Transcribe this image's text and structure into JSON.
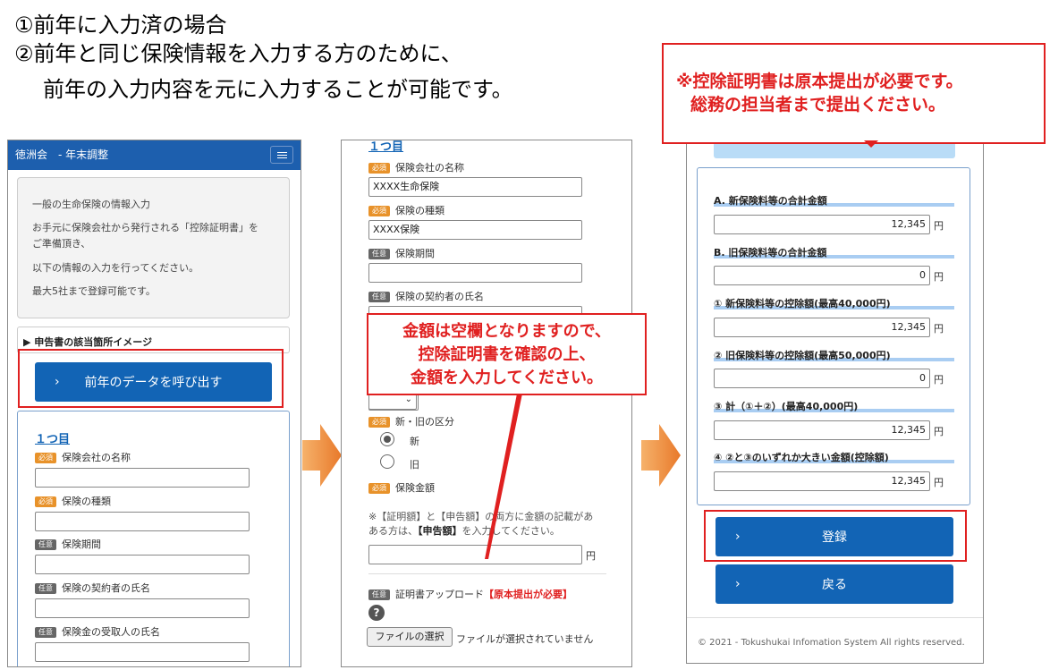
{
  "slide": {
    "line1": "①前年に入力済の場合",
    "line2": "②前年と同じ保険情報を入力する方のために、",
    "line3": "前年の入力内容を元に入力することが可能です。"
  },
  "notice": {
    "line1": "※控除証明書は原本提出が必要です。",
    "line2": "総務の担当者まで提出ください。"
  },
  "callout": {
    "line1": "金額は空欄となりますので、",
    "line2": "控除証明書を確認の上、",
    "line3": "金額を入力してください。"
  },
  "screen1": {
    "app_title": "徳洲会　- 年末調整",
    "intro": {
      "title": "一般の生命保険の情報入力",
      "p1a": "お手元に保険会社から発行される「控除証明書」を",
      "p1b": "ご準備頂き、",
      "p2": "以下の情報の入力を行ってください。",
      "p3": "最大5社まで登録可能です。"
    },
    "toggle": "▶ 申告書の該当箇所イメージ",
    "load_button": "前年のデータを呼び出す",
    "section_title": "１つ目",
    "fields": [
      {
        "badge": "必須",
        "label": "保険会社の名称",
        "value": ""
      },
      {
        "badge": "必須",
        "label": "保険の種類",
        "value": ""
      },
      {
        "badge": "任意",
        "label": "保険期間",
        "value": ""
      },
      {
        "badge": "任意",
        "label": "保険の契約者の氏名",
        "value": ""
      },
      {
        "badge": "任意",
        "label": "保険金の受取人の氏名",
        "value": ""
      }
    ]
  },
  "screen2": {
    "section_title": "１つ目",
    "fields": [
      {
        "badge": "必須",
        "label": "保険会社の名称",
        "value": "XXXX生命保険"
      },
      {
        "badge": "必須",
        "label": "保険の種類",
        "value": "XXXX保険"
      },
      {
        "badge": "任意",
        "label": "保険期間",
        "value": ""
      },
      {
        "badge": "任意",
        "label": "保険の契約者の氏名",
        "value": ""
      }
    ],
    "kubun_badge": "必須",
    "kubun_label": "新・旧の区分",
    "radio_new": "新",
    "radio_old": "旧",
    "amount_badge": "必須",
    "amount_label": "保険金額",
    "note_a": "※【証明額】と【申告額】の両方に金額の記載がある方は、",
    "note_b1": "ある方は、",
    "note_b2": "【申告額】",
    "note_b3": "を入力してください。",
    "note_a_short": "※【証明額】と【申告額】の両方に金額の記載があ",
    "amount_value": "",
    "yen": "円",
    "upload_badge": "任意",
    "upload_label": "証明書アップロード",
    "upload_required": "【原本提出が必要】",
    "help_icon": "?",
    "file_button": "ファイルの選択",
    "file_status": "ファイルが選択されていません"
  },
  "screen3": {
    "rows": [
      {
        "label": "A. 新保険料等の合計金額",
        "value": "12,345"
      },
      {
        "label": "B. 旧保険料等の合計金額",
        "value": "0"
      },
      {
        "label": "① 新保険料等の控除額(最高40,000円)",
        "value": "12,345"
      },
      {
        "label": "② 旧保険料等の控除額(最高50,000円)",
        "value": "0"
      },
      {
        "label": "③ 計（①＋②）(最高40,000円)",
        "value": "12,345"
      },
      {
        "label": "④ ②と③のいずれか大きい金額(控除額)",
        "value": "12,345"
      }
    ],
    "yen": "円",
    "register_button": "登録",
    "back_button": "戻る",
    "footer": "© 2021 - Tokushukai Infomation System All rights reserved."
  }
}
